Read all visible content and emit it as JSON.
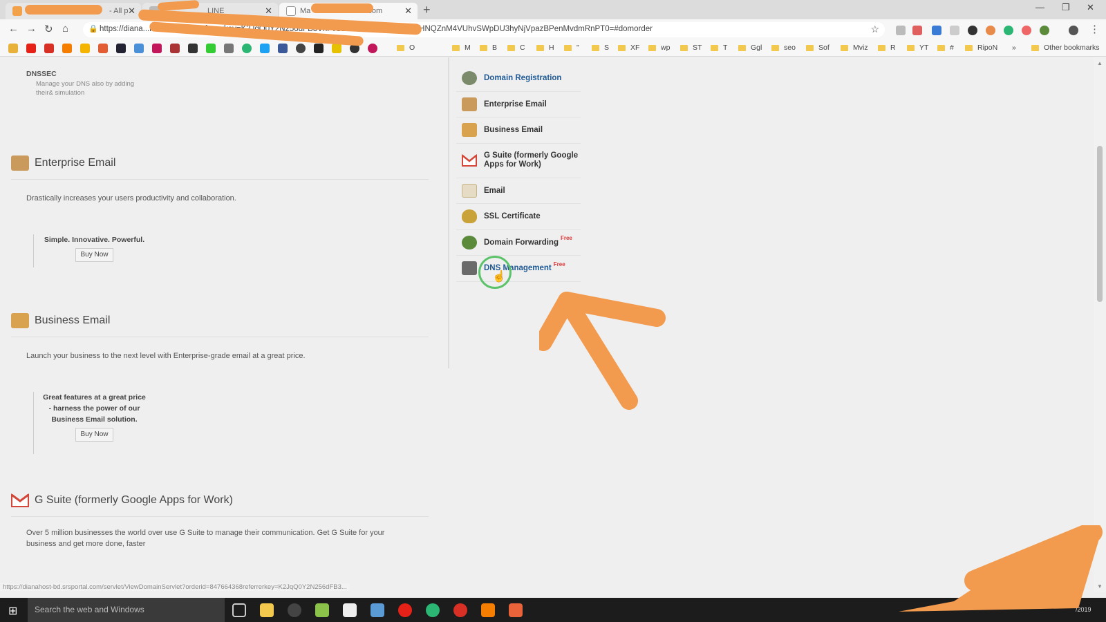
{
  "browser": {
    "tabs": [
      {
        "label": "- All p",
        "color": "#f2a24b",
        "active": false
      },
      {
        "label": "LINE",
        "color": "#bbbbbb",
        "active": false
      },
      {
        "label": "Ma",
        "suffix": ".com",
        "color": "#cccccc",
        "active": true
      }
    ],
    "url": "https://diana...k=847664368referrerkey=K2JqQ0Y2N256dFB3VnFvSE9FakxET3NSMU1IOHNQZnM4VUhvSWpDU3hyNjVpazBPenMvdmRnPT0=#domorder",
    "bookmarks": [
      "O",
      "M",
      "B",
      "C",
      "H",
      "\"",
      "S",
      "XF",
      "wp",
      "ST",
      "T",
      "Ggl",
      "seo",
      "Sof",
      "Mviz",
      "R",
      "YT",
      "#",
      "RipoN"
    ],
    "more_bookmarks": "»",
    "other_bookmarks": "Other bookmarks"
  },
  "main": {
    "dnssec": {
      "title": "DNSSEC",
      "description": "Manage your DNS also by adding their& simulation"
    },
    "sections": [
      {
        "title": "Enterprise Email",
        "description": "Drastically increases your users productivity and collaboration.",
        "promo": [
          "Simple. Innovative. Powerful."
        ],
        "buy_label": "Buy Now"
      },
      {
        "title": "Business Email",
        "description": "Launch your business to the next level with Enterprise-grade email at a great price.",
        "promo": [
          "Great features at a great price",
          "- harness the power of our",
          "Business Email solution."
        ],
        "buy_label": "Buy Now"
      },
      {
        "title": "G Suite (formerly Google Apps for Work)",
        "description_lines": [
          "Over 5 million businesses the world over use G Suite to manage their communication. Get G Suite for your",
          "business and get more done, faster"
        ]
      }
    ],
    "status_url": "https://dianahost-bd.srsportal.com/servlet/ViewDomainServlet?orderid=847664368referrerkey=K2JqQ0Y2N256dFB3..."
  },
  "sidebar": {
    "items": [
      {
        "label": "Domain Registration",
        "icon": "globe-icon",
        "color": "#7a8a6a",
        "active": true
      },
      {
        "label": "Enterprise Email",
        "icon": "envelope-box-icon",
        "color": "#c99a5b",
        "active": false
      },
      {
        "label": "Business Email",
        "icon": "briefcase-icon",
        "color": "#d9a24f",
        "active": false
      },
      {
        "label": "G Suite (formerly Google Apps for Work)",
        "label_line1": "G Suite (formerly Google",
        "label_line2": "Apps for Work)",
        "icon": "gmail-icon",
        "color": "#d44638",
        "active": false
      },
      {
        "label": "Email",
        "icon": "mail-icon",
        "color": "#c9b48a",
        "active": false
      },
      {
        "label": "SSL Certificate",
        "icon": "shield-icon",
        "color": "#c9a23a",
        "active": false
      },
      {
        "label": "Domain Forwarding",
        "badge": "Free",
        "icon": "forward-icon",
        "color": "#5a8a3a",
        "active": false
      },
      {
        "label": "DNS Management",
        "badge": "Free",
        "icon": "dns-servers-icon",
        "color": "#6a6a6a",
        "active": true
      }
    ]
  },
  "taskbar": {
    "search_placeholder": "Search the web and Windows",
    "date_fragment": "/2019"
  },
  "colors": {
    "annotation": "#f29a4d",
    "link_active": "#1f5a94",
    "cursor_ring": "#5cc36a"
  }
}
